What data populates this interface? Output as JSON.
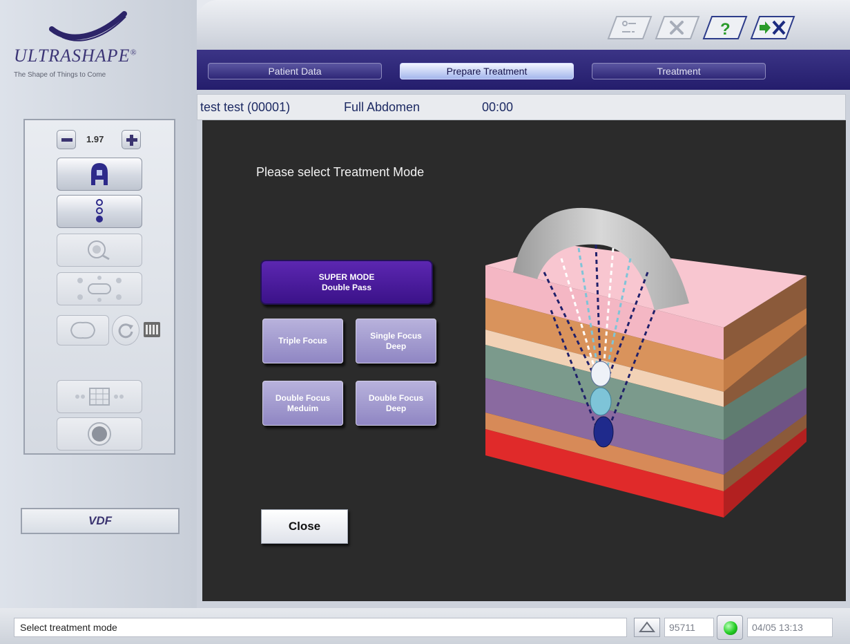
{
  "brand": {
    "name": "ULTRASHAPE",
    "registered": "®",
    "tagline": "The Shape of Things to Come"
  },
  "sidebar": {
    "zoom_value": "1.97",
    "vdf_label": "VDF",
    "tools": [
      {
        "icon": "transducer-icon",
        "enabled": true
      },
      {
        "icon": "focus-points-icon",
        "enabled": true
      },
      {
        "icon": "magnify-icon",
        "enabled": false
      },
      {
        "icon": "pattern-icon",
        "enabled": false
      },
      {
        "icon": "body-outline-icon",
        "enabled": false
      },
      {
        "icon": "rotate-icon",
        "enabled": false
      },
      {
        "icon": "grid-icon",
        "enabled": false
      },
      {
        "icon": "circle-icon",
        "enabled": false
      }
    ]
  },
  "header": {
    "icon_buttons": [
      "settings-list-icon",
      "tools-icon",
      "help-icon",
      "exit-icon"
    ]
  },
  "nav": {
    "tabs": [
      {
        "label": "Patient Data",
        "active": false
      },
      {
        "label": "Prepare Treatment",
        "active": true
      },
      {
        "label": "Treatment",
        "active": false
      }
    ]
  },
  "info": {
    "patient": "test test (00001)",
    "area": "Full Abdomen",
    "time": "00:00"
  },
  "main": {
    "prompt": "Please select Treatment Mode",
    "super_mode": {
      "line1": "SUPER MODE",
      "line2": "Double Pass"
    },
    "modes": [
      {
        "line1": "Triple Focus",
        "line2": ""
      },
      {
        "line1": "Single Focus",
        "line2": "Deep"
      },
      {
        "line1": "Double Focus",
        "line2": "Meduim"
      },
      {
        "line1": "Double Focus",
        "line2": "Deep"
      }
    ],
    "close_label": "Close"
  },
  "status": {
    "message": "Select treatment mode",
    "counter": "95711",
    "datetime": "04/05 13:13",
    "led_color": "#22cc22"
  },
  "colors": {
    "nav_bar": "#2a2275",
    "super_mode": "#4a1a9c",
    "mode_button": "#a39bd0",
    "panel_bg": "#2b2b2b"
  }
}
